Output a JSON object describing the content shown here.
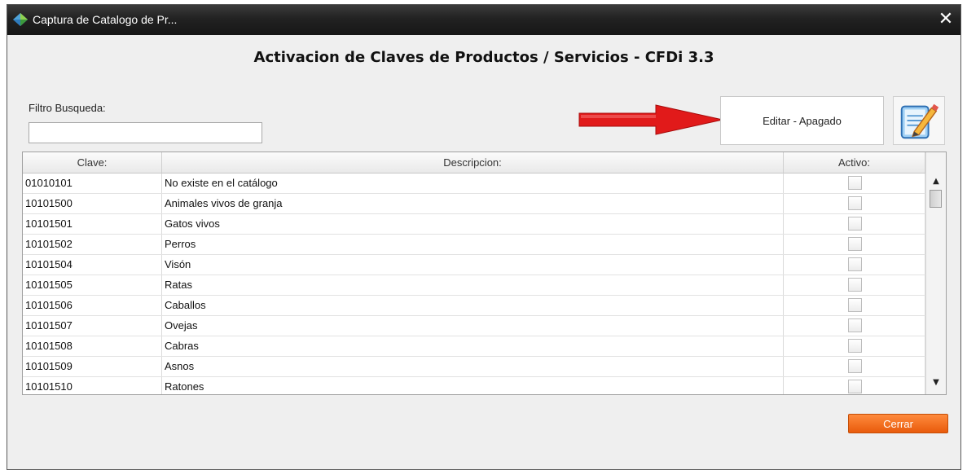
{
  "window": {
    "title": "Captura de Catalogo de Pr...",
    "close_glyph": "✕",
    "icon": "app-diamond-icon"
  },
  "heading": "Activacion de Claves de Productos / Servicios - CFDi 3.3",
  "filter": {
    "label": "Filtro Busqueda:",
    "value": "",
    "placeholder": ""
  },
  "toolbar": {
    "edit_label": "Editar - Apagado",
    "notepad_icon": "notepad-pencil-icon",
    "arrow_color": "#e11a1a"
  },
  "table": {
    "columns": [
      "Clave:",
      "Descripcion:",
      "Activo:"
    ],
    "rows": [
      {
        "clave": "01010101",
        "descripcion": "No existe en el catálogo",
        "activo": false
      },
      {
        "clave": "10101500",
        "descripcion": "Animales vivos de granja",
        "activo": false
      },
      {
        "clave": "10101501",
        "descripcion": "Gatos vivos",
        "activo": false
      },
      {
        "clave": "10101502",
        "descripcion": "Perros",
        "activo": false
      },
      {
        "clave": "10101504",
        "descripcion": "Visón",
        "activo": false
      },
      {
        "clave": "10101505",
        "descripcion": "Ratas",
        "activo": false
      },
      {
        "clave": "10101506",
        "descripcion": "Caballos",
        "activo": false
      },
      {
        "clave": "10101507",
        "descripcion": "Ovejas",
        "activo": false
      },
      {
        "clave": "10101508",
        "descripcion": "Cabras",
        "activo": false
      },
      {
        "clave": "10101509",
        "descripcion": "Asnos",
        "activo": false
      },
      {
        "clave": "10101510",
        "descripcion": "Ratones",
        "activo": false
      }
    ]
  },
  "footer": {
    "close_label": "Cerrar",
    "accent": "#f26b1d"
  }
}
